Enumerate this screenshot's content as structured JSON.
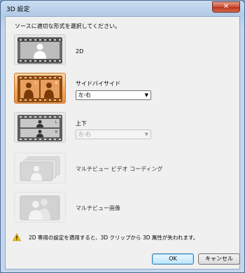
{
  "window": {
    "title": "3D 設定",
    "close_glyph": "✕"
  },
  "instruction": "ソースに適切な形式を選択してください。",
  "options": [
    {
      "label": "2D",
      "icon": "film-person-2d-icon"
    },
    {
      "label": "サイドバイサイド",
      "icon": "film-side-by-side-icon",
      "selected": true,
      "dropdown": "左-右",
      "dropdown_enabled": true
    },
    {
      "label": "上下",
      "icon": "film-top-bottom-icon",
      "dropdown": "左-右",
      "dropdown_enabled": false
    },
    {
      "label": "マルチビュー ビデオ コーディング",
      "icon": "multiview-video-coding-icon",
      "disabled": true
    },
    {
      "label": "マルチビュー画像",
      "icon": "multiview-image-icon",
      "disabled": true
    }
  ],
  "warning": "2D 専用の設定を適用すると、3D クリップから 3D 属性が失われます。",
  "buttons": {
    "ok": "OK",
    "cancel": "キャンセル"
  },
  "colors": {
    "selected_tile": "#f2a658",
    "warning": "#f5c400"
  }
}
